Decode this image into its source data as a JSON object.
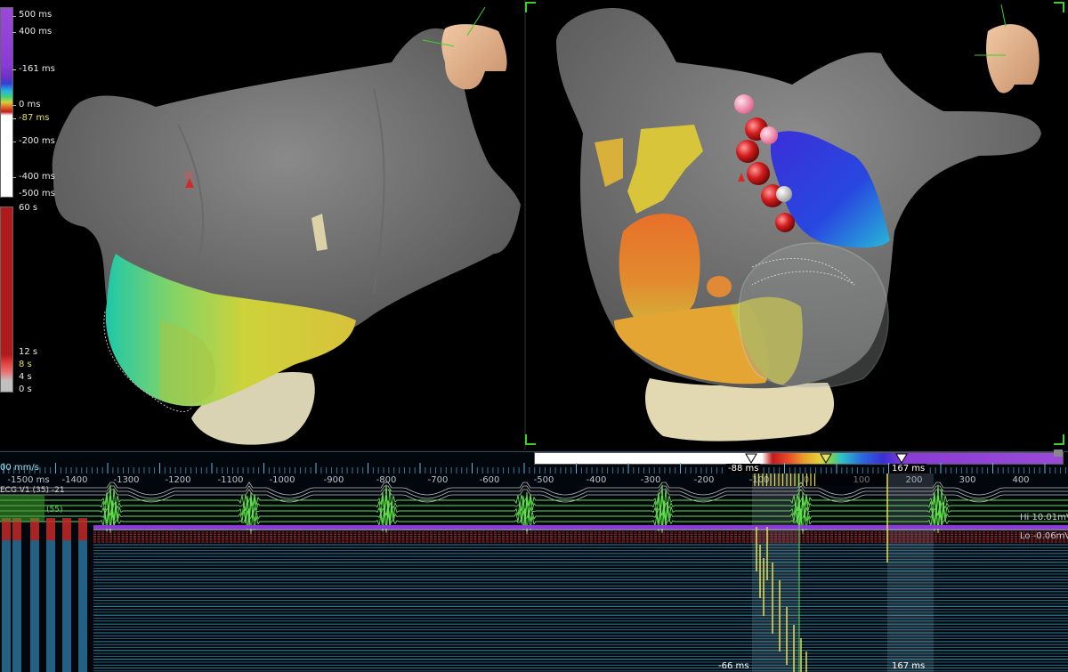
{
  "lat_scale": {
    "labels": [
      "500 ms",
      "400 ms",
      "161 ms",
      "0 ms",
      "-87 ms",
      "-200 ms",
      "-400 ms",
      "-500 ms"
    ],
    "label_161_prefix": "-"
  },
  "voltage_scale": {
    "labels": [
      "60 s",
      "12 s",
      "8 s",
      "4 s",
      "0 s"
    ]
  },
  "timeline": {
    "speed": "00 mm/s",
    "first_tick": "-1500 ms",
    "ticks": [
      "-1400",
      "-1300",
      "-1200",
      "-1100",
      "-1000",
      "-900",
      "-800",
      "-700",
      "-600",
      "-500",
      "-400",
      "-300",
      "-200",
      "-100",
      "0",
      "100",
      "200",
      "300",
      "400"
    ]
  },
  "window": {
    "left_marker": "-88 ms",
    "right_marker": "167 ms",
    "bottom_left": "-66 ms",
    "bottom_right": "167 ms"
  },
  "channels": {
    "ecg": "ECG V1 (35) -21",
    "stim": "(55)",
    "hi_label": "Hi 10.01mV",
    "lo_label": "Lo -0.06mV"
  },
  "colors": {
    "accent_green": "#3bd12a",
    "lat_purple": "#8a3bd6",
    "ecg_green": "#5fe04a",
    "egm_blue": "#3aa7c8",
    "marker_yellow": "#e8e04a"
  }
}
